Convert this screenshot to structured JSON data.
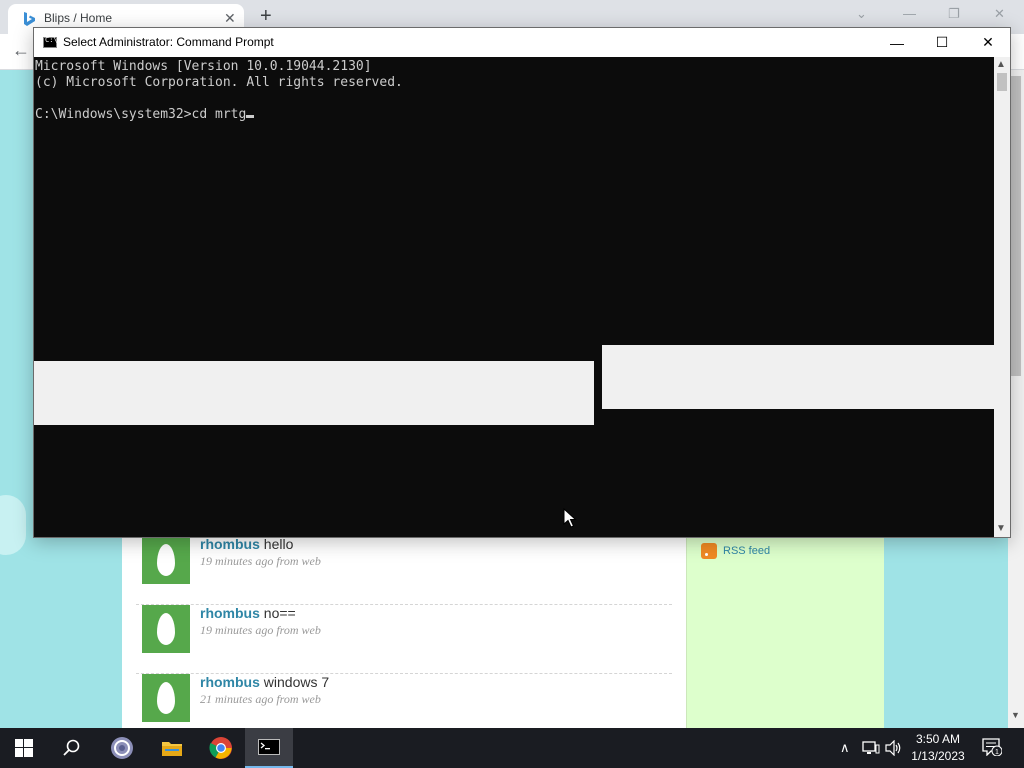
{
  "browser": {
    "tab_title": "Blips / Home",
    "tab_close": "✕",
    "new_tab": "+",
    "tab_search": "⌄",
    "minimize": "—",
    "restore": "❐",
    "close": "✕",
    "back": "←"
  },
  "cmd": {
    "title": "Select Administrator:  Command Prompt",
    "icon_text": "C:\\_",
    "lines": [
      "Microsoft Windows [Version 10.0.19044.2130]",
      "(c) Microsoft Corporation. All rights reserved.",
      "",
      "C:\\Windows\\system32>cd mrtg"
    ],
    "minimize": "—",
    "maximize": "☐",
    "close": "✕"
  },
  "statuses": [
    {
      "user": "rhombus",
      "text": "hello",
      "meta": "19 minutes ago from web"
    },
    {
      "user": "rhombus",
      "text": "no==",
      "meta": "19 minutes ago from web"
    },
    {
      "user": "rhombus",
      "text": "windows 7",
      "meta": "21 minutes ago from web"
    }
  ],
  "sidebar": {
    "rss_label": "RSS feed"
  },
  "taskbar": {
    "time": "3:50 AM",
    "date": "1/13/2023",
    "notification_count": "1",
    "tray_chevron": "∧"
  },
  "colors": {
    "page_background": "#9fe3e6",
    "sidebar_background": "#ddffcc",
    "username": "#2f86a6",
    "avatar_green": "#56a84b",
    "console_background": "#0c0c0c",
    "taskbar": "#1a1c22"
  }
}
